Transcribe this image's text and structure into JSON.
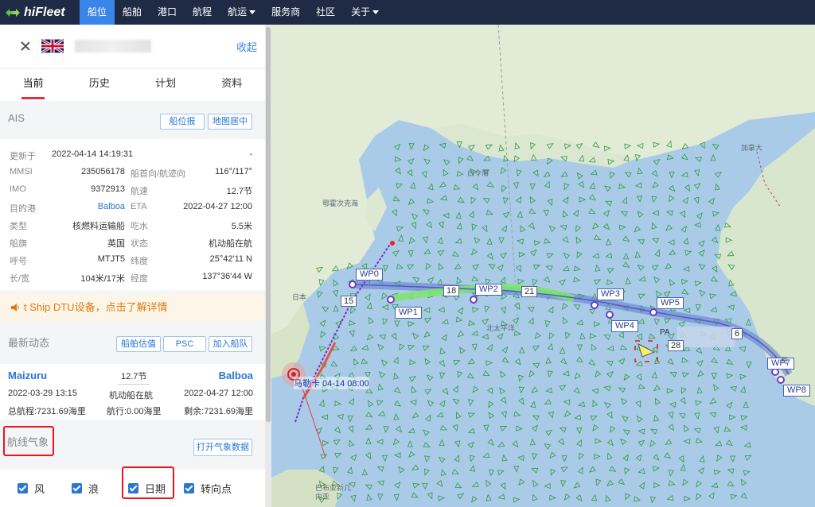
{
  "nav": {
    "logo": "hiFleet",
    "items": [
      {
        "label": "船位",
        "active": true,
        "caret": false
      },
      {
        "label": "船舶",
        "active": false,
        "caret": false
      },
      {
        "label": "港口",
        "active": false,
        "caret": false
      },
      {
        "label": "航程",
        "active": false,
        "caret": false
      },
      {
        "label": "航运",
        "active": false,
        "caret": true
      },
      {
        "label": "服务商",
        "active": false,
        "caret": false
      },
      {
        "label": "社区",
        "active": false,
        "caret": false
      },
      {
        "label": "关于",
        "active": false,
        "caret": true
      }
    ]
  },
  "ship": {
    "collapse": "收起",
    "flag_icon": "uk-flag-icon"
  },
  "tabs": [
    "当前",
    "历史",
    "计划",
    "资料"
  ],
  "ais": {
    "title": "AIS",
    "btn_report": "船位报",
    "btn_center": "地图居中",
    "updated_label": "更新于",
    "updated_value": "2022-04-14 14:19:31",
    "updated_right": "-",
    "rows": [
      {
        "l1": "MMSI",
        "v1": "235056178",
        "l2": "船首向/航迹向",
        "v2": "116°/117°"
      },
      {
        "l1": "IMO",
        "v1": "9372913",
        "l2": "航速",
        "v2": "12.7节"
      },
      {
        "l1": "目的港",
        "v1": "Balboa",
        "l2": "ETA",
        "v2": "2022-04-27 12:00"
      },
      {
        "l1": "类型",
        "v1": "核燃料运输船",
        "l2": "吃水",
        "v2": "5.5米"
      },
      {
        "l1": "船旗",
        "v1": "英国",
        "l2": "状态",
        "v2": "机动船在航"
      },
      {
        "l1": "呼号",
        "v1": "MTJT5",
        "l2": "纬度",
        "v2": "25°42'11 N"
      },
      {
        "l1": "长/宽",
        "v1": "104米/17米",
        "l2": "经度",
        "v2": "137°36'44 W"
      }
    ]
  },
  "dtu": {
    "text": "t Ship DTU设备，点击了解详情"
  },
  "recent": {
    "title": "最新动态",
    "btn_valuation": "船舶估值",
    "btn_psc": "PSC",
    "btn_fleet": "加入船队",
    "from_port": "Maizuru",
    "to_port": "Balboa",
    "speed": "12.7节",
    "depart_time": "2022-03-29 13:15",
    "status": "机动船在航",
    "eta": "2022-04-27 12:00",
    "total": "总航程:7231.69海里",
    "sailed": "航行:0.00海里",
    "remaining": "剩余:7231.69海里"
  },
  "weather": {
    "title": "航线气象",
    "btn_open": "打开气象数据",
    "checks": [
      "风",
      "浪",
      "日期",
      "转向点"
    ]
  },
  "map": {
    "waypoints": [
      "WP0",
      "WP1",
      "WP2",
      "WP3",
      "WP4",
      "WP5",
      "WP7",
      "WP8"
    ],
    "days": [
      "15",
      "18",
      "21",
      "28",
      "6"
    ],
    "typhoon_label": "马勒卡 04-14 08:00",
    "labels": {
      "canada": "加拿大",
      "japan": "日本",
      "ship_prefix": "PA",
      "mexico": "哥",
      "beaufort": "白令海",
      "pacific": "北太平洋",
      "okhotsk": "鄂霍次克海",
      "philippines": "巴布亚新几内亚"
    }
  }
}
